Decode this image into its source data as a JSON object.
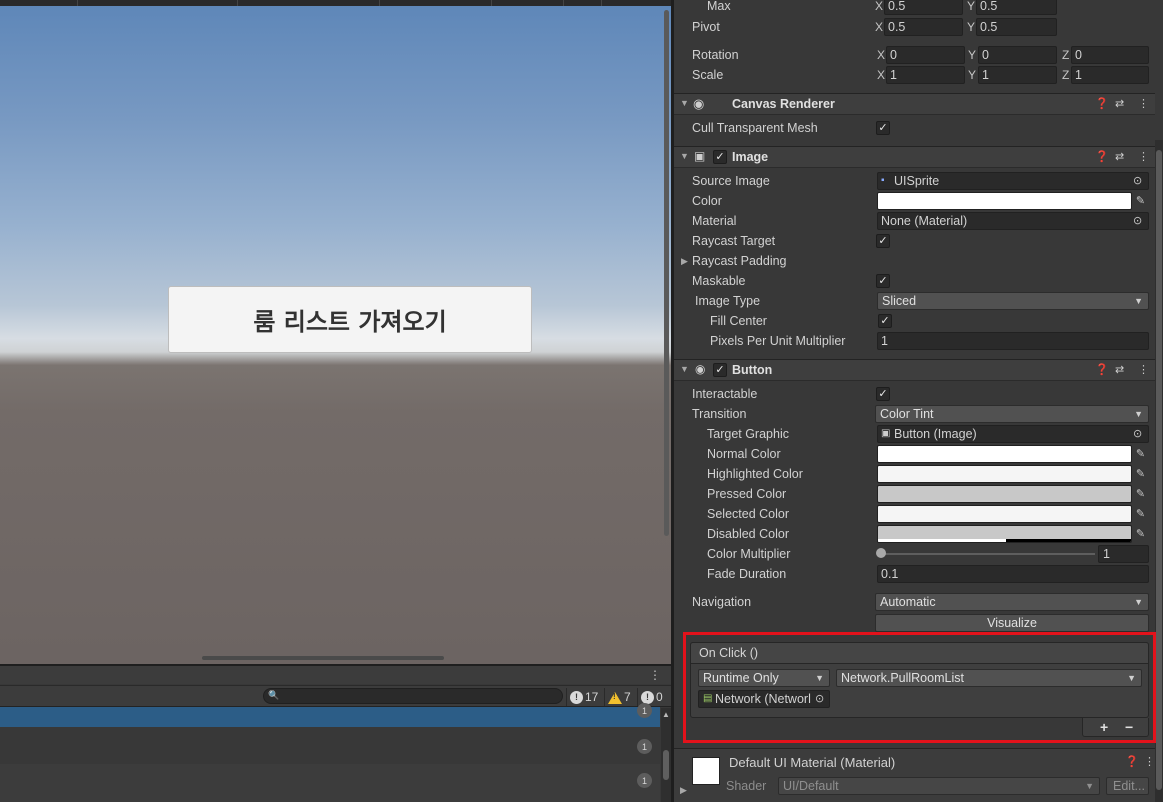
{
  "game": {
    "button_text": "룸 리스트 가져오기"
  },
  "console": {
    "menu_icon": "⋮",
    "search_placeholder": "",
    "info_count": "17",
    "warn_count": "7",
    "error_count": "0",
    "rows": [
      {
        "count": "1"
      },
      {
        "count": "1"
      },
      {
        "count": "1"
      }
    ]
  },
  "rect_transform": {
    "max_label": "Max",
    "max_x": "0.5",
    "max_y": "0.5",
    "pivot_label": "Pivot",
    "pivot_x": "0.5",
    "pivot_y": "0.5",
    "rotation_label": "Rotation",
    "rot_x": "0",
    "rot_y": "0",
    "rot_z": "0",
    "scale_label": "Scale",
    "scale_x": "1",
    "scale_y": "1",
    "scale_z": "1",
    "axis_x": "X",
    "axis_y": "Y",
    "axis_z": "Z"
  },
  "canvas_renderer": {
    "title": "Canvas Renderer",
    "cull_label": "Cull Transparent Mesh"
  },
  "image": {
    "title": "Image",
    "source_image_label": "Source Image",
    "source_image_value": "UISprite",
    "color_label": "Color",
    "material_label": "Material",
    "material_value": "None (Material)",
    "raycast_target_label": "Raycast Target",
    "raycast_padding_label": "Raycast Padding",
    "maskable_label": "Maskable",
    "image_type_label": "Image Type",
    "image_type_value": "Sliced",
    "fill_center_label": "Fill Center",
    "ppu_label": "Pixels Per Unit Multiplier",
    "ppu_value": "1"
  },
  "button": {
    "title": "Button",
    "interactable_label": "Interactable",
    "transition_label": "Transition",
    "transition_value": "Color Tint",
    "target_graphic_label": "Target Graphic",
    "target_graphic_value": "Button (Image)",
    "normal_color_label": "Normal Color",
    "highlighted_color_label": "Highlighted Color",
    "pressed_color_label": "Pressed Color",
    "selected_color_label": "Selected Color",
    "disabled_color_label": "Disabled Color",
    "color_multiplier_label": "Color Multiplier",
    "color_multiplier_value": "1",
    "color_multiplier_fraction": 0,
    "fade_duration_label": "Fade Duration",
    "fade_duration_value": "0.1",
    "navigation_label": "Navigation",
    "navigation_value": "Automatic",
    "visualize_label": "Visualize",
    "on_click_label": "On Click ()",
    "runtime_value": "Runtime Only",
    "function_value": "Network.PullRoomList",
    "object_value": "Network (Networl",
    "add_label": "+",
    "remove_label": "−"
  },
  "material_footer": {
    "name": "Default UI Material (Material)",
    "shader_label": "Shader",
    "shader_value": "UI/Default",
    "edit_label": "Edit..."
  },
  "colors": {
    "accent_highlight": "#e3121b",
    "console_selected_row": "#2c5d87",
    "normal_color": "#ffffff",
    "highlighted_color": "#f5f5f5",
    "pressed_color": "#c8c8c8",
    "selected_color": "#f5f5f5",
    "disabled_color": "#c8c8c8"
  },
  "icons": {
    "help": "help-icon",
    "preset": "preset-icon",
    "more": "more-icon",
    "eye": "eye-icon",
    "image": "image-icon",
    "radio": "button-component-icon"
  }
}
